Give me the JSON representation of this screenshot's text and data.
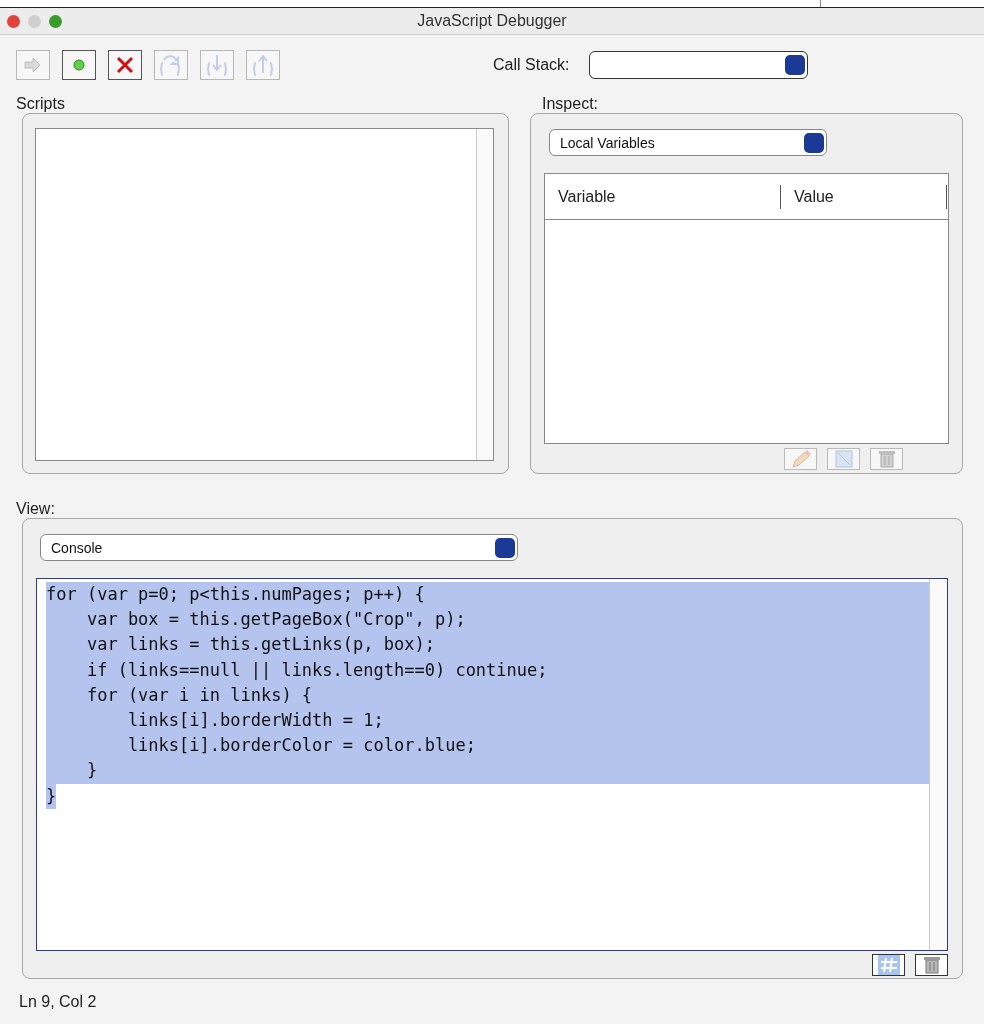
{
  "window": {
    "title": "JavaScript Debugger"
  },
  "toolbar": {
    "buttons": [
      {
        "kind": "resume",
        "disabled": true
      },
      {
        "kind": "breakpoint",
        "disabled": false
      },
      {
        "kind": "stop",
        "disabled": false
      },
      {
        "kind": "step-over",
        "disabled": true
      },
      {
        "kind": "step-into",
        "disabled": true
      },
      {
        "kind": "step-out",
        "disabled": true
      }
    ],
    "call_stack": {
      "label": "Call Stack:"
    }
  },
  "scripts": {
    "label": "Scripts"
  },
  "inspect": {
    "label": "Inspect:",
    "dropdown": "Local Variables",
    "columns": [
      "Variable",
      "Value"
    ],
    "buttons": [
      {
        "kind": "edit",
        "disabled": true
      },
      {
        "kind": "watch",
        "disabled": true
      },
      {
        "kind": "delete",
        "disabled": true
      }
    ]
  },
  "view": {
    "label": "View:",
    "dropdown": "Console",
    "lines": [
      {
        "text": "for (var p=0; p<this.numPages; p++) {",
        "selected": true
      },
      {
        "text": "    var box = this.getPageBox(\"Crop\", p);",
        "selected": true
      },
      {
        "text": "    var links = this.getLinks(p, box);",
        "selected": true
      },
      {
        "text": "    if (links==null || links.length==0) continue;",
        "selected": true
      },
      {
        "text": "    for (var i in links) {",
        "selected": true
      },
      {
        "text": "        links[i].borderWidth = 1;",
        "selected": true
      },
      {
        "text": "        links[i].borderColor = color.blue;",
        "selected": true
      },
      {
        "text": "    }",
        "selected": true
      },
      {
        "text": "}",
        "selected": true
      }
    ],
    "buttons": [
      {
        "kind": "evaluate",
        "disabled": false
      },
      {
        "kind": "delete",
        "disabled": false
      }
    ]
  },
  "status_bar": "Ln 9, Col 2"
}
